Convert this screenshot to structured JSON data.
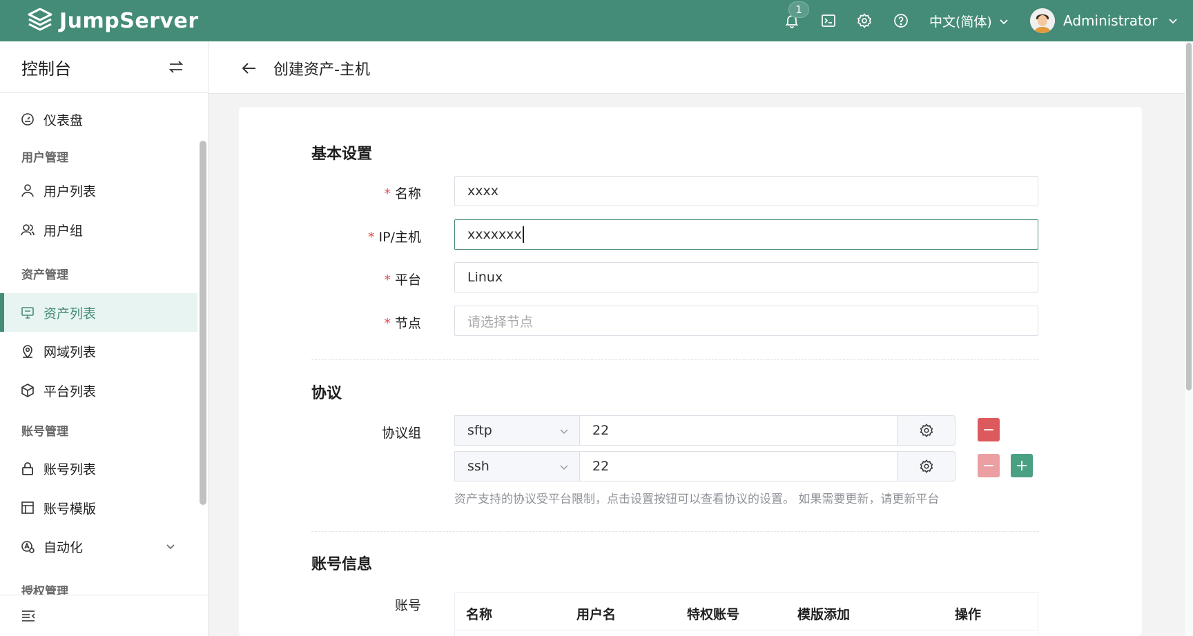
{
  "header": {
    "app_name": "JumpServer",
    "notification_count": "1",
    "language": "中文(简体)",
    "username": "Administrator",
    "brand_color": "#458c78"
  },
  "sidebar": {
    "title": "控制台",
    "groups": {
      "user_mgmt": "用户管理",
      "asset_mgmt": "资产管理",
      "account_mgmt": "账号管理",
      "perm_mgmt": "授权管理"
    },
    "items": {
      "dashboard": "仪表盘",
      "user_list": "用户列表",
      "user_group": "用户组",
      "asset_list": "资产列表",
      "domain_list": "网域列表",
      "platform_list": "平台列表",
      "account_list": "账号列表",
      "account_template": "账号模版",
      "automation": "自动化"
    },
    "active_item": "资产列表"
  },
  "page": {
    "title": "创建资产-主机"
  },
  "form": {
    "basic_title": "基本设置",
    "name_label": "名称",
    "name_value": "xxxx",
    "address_label": "IP/主机",
    "address_value": "xxxxxxx",
    "platform_label": "平台",
    "platform_value": "Linux",
    "node_label": "节点",
    "node_placeholder": "请选择节点",
    "protocol_title": "协议",
    "protocol_group_label": "协议组",
    "protocols": [
      {
        "name": "sftp",
        "port": "22"
      },
      {
        "name": "ssh",
        "port": "22"
      }
    ],
    "protocol_hint": "资产支持的协议受平台限制，点击设置按钮可以查看协议的设置。 如果需要更新，请更新平台",
    "account_title": "账号信息",
    "account_label": "账号",
    "account_columns": [
      "名称",
      "用户名",
      "特权账号",
      "模版添加",
      "操作"
    ]
  }
}
